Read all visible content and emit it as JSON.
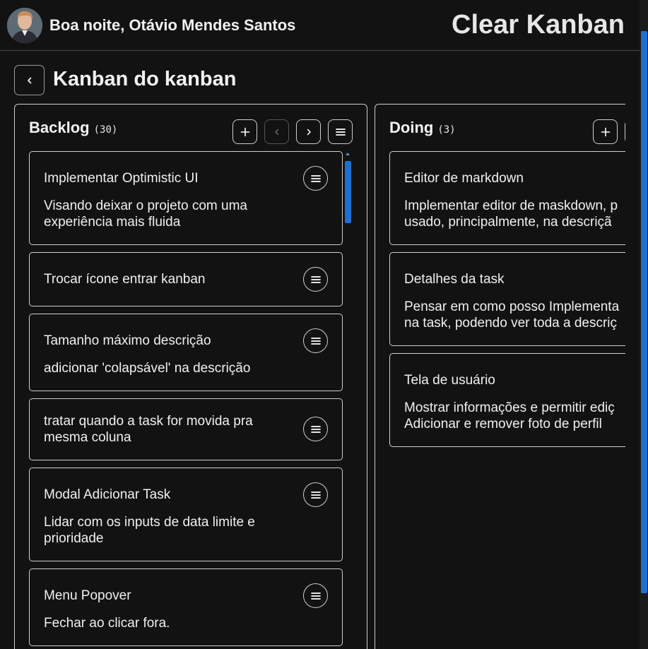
{
  "header": {
    "greeting": "Boa noite, Otávio Mendes Santos",
    "app_title": "Clear Kanban"
  },
  "board": {
    "title": "Kanban do kanban"
  },
  "icons": {
    "back": "chevron-left-icon",
    "add": "plus-icon",
    "prev": "chevron-left-icon",
    "next": "chevron-right-icon",
    "menu": "hamburger-icon"
  },
  "colors": {
    "background": "#121212",
    "border": "#cfcfcf",
    "accent": "#1f6fd1"
  },
  "columns": [
    {
      "name": "Backlog",
      "count": "(30)",
      "cards": [
        {
          "title": "Implementar Optimistic UI",
          "description": "Visando deixar o projeto com uma\nexperiência mais fluida"
        },
        {
          "title": "Trocar ícone entrar kanban",
          "description": ""
        },
        {
          "title": "Tamanho máximo descrição",
          "description": "adicionar 'colapsável' na descrição"
        },
        {
          "title": "tratar quando a task for movida pra mesma coluna",
          "description": ""
        },
        {
          "title": "Modal Adicionar Task",
          "description": "Lidar com os inputs de data limite e\nprioridade"
        },
        {
          "title": "Menu Popover",
          "description": "Fechar ao clicar fora."
        }
      ]
    },
    {
      "name": "Doing",
      "count": "(3)",
      "cards": [
        {
          "title": "Editor de markdown",
          "description": "Implementar editor de maskdown, p\nusado, principalmente, na descriçã"
        },
        {
          "title": "Detalhes da task",
          "description": "Pensar em como posso Implementa\nna task, podendo ver toda a descriç"
        },
        {
          "title": "Tela de usuário",
          "description": "Mostrar informações e permitir ediç\nAdicionar e remover foto de perfil"
        }
      ]
    }
  ]
}
